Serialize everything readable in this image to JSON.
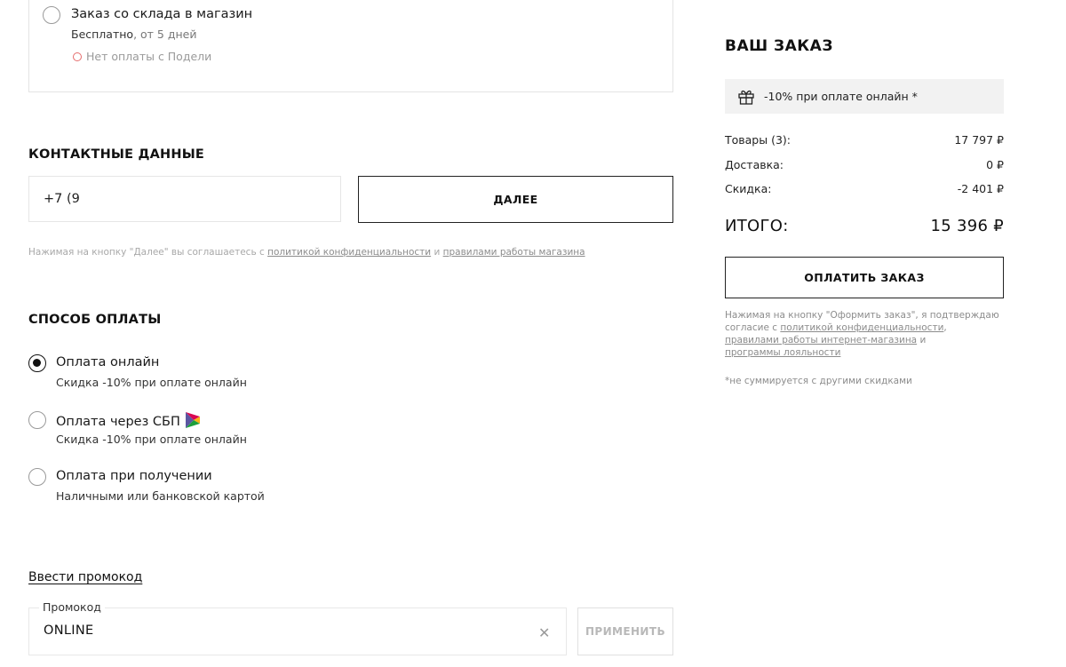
{
  "delivery": {
    "option_title": "Заказ со склада в магазин",
    "option_price": "Бесплатно",
    "option_eta": ", от 5 дней",
    "no_installments": "Нет оплаты с Подели"
  },
  "contacts": {
    "title": "КОНТАКТНЫЕ ДАННЫЕ",
    "phone_value": "+7 (9",
    "next_label": "ДАЛЕЕ",
    "legal_prefix": "Нажимая на кнопку \"Далее\" вы соглашаетесь с ",
    "legal_privacy": "политикой конфиденциальности",
    "legal_and": " и ",
    "legal_rules": "правилами работы магазина"
  },
  "payment": {
    "title": "СПОСОБ ОПЛАТЫ",
    "options": [
      {
        "title": "Оплата онлайн",
        "sub": "Скидка -10% при оплате онлайн",
        "selected": true
      },
      {
        "title": "Оплата через СБП",
        "sub": "Скидка -10% при оплате онлайн",
        "selected": false
      },
      {
        "title": "Оплата при получении",
        "sub": "Наличными или банковской картой",
        "selected": false
      }
    ]
  },
  "promo": {
    "link_label": "Ввести промокод",
    "field_label": "Промокод",
    "value": "ONLINE",
    "clear_icon": "close-icon",
    "apply_label": "ПРИМЕНИТЬ"
  },
  "order": {
    "title": "ВАШ ЗАКАЗ",
    "banner": "-10% при оплате онлайн *",
    "items_label": "Товары (3):",
    "items_value": "17 797 ₽",
    "delivery_label": "Доставка:",
    "delivery_value": "0 ₽",
    "discount_label": "Скидка:",
    "discount_value": "-2 401 ₽",
    "total_label": "ИТОГО:",
    "total_value": "15 396 ₽",
    "pay_label": "ОПЛАТИТЬ ЗАКАЗ",
    "legal_prefix": "Нажимая на кнопку \"Оформить заказ\", я подтверждаю согласие с ",
    "legal_privacy": "политикой конфиденциальности",
    "legal_comma": ",",
    "legal_rules": "правилами работы интернет-магазина",
    "legal_and": " и ",
    "legal_loyalty": "программы лояльности",
    "footnote": "*не суммируется с другими скидками"
  },
  "colors": {
    "accent": "#111111",
    "muted": "#8c8c8c",
    "banner_bg": "#f2f2f2",
    "installment_ring": "#e56b6b"
  }
}
